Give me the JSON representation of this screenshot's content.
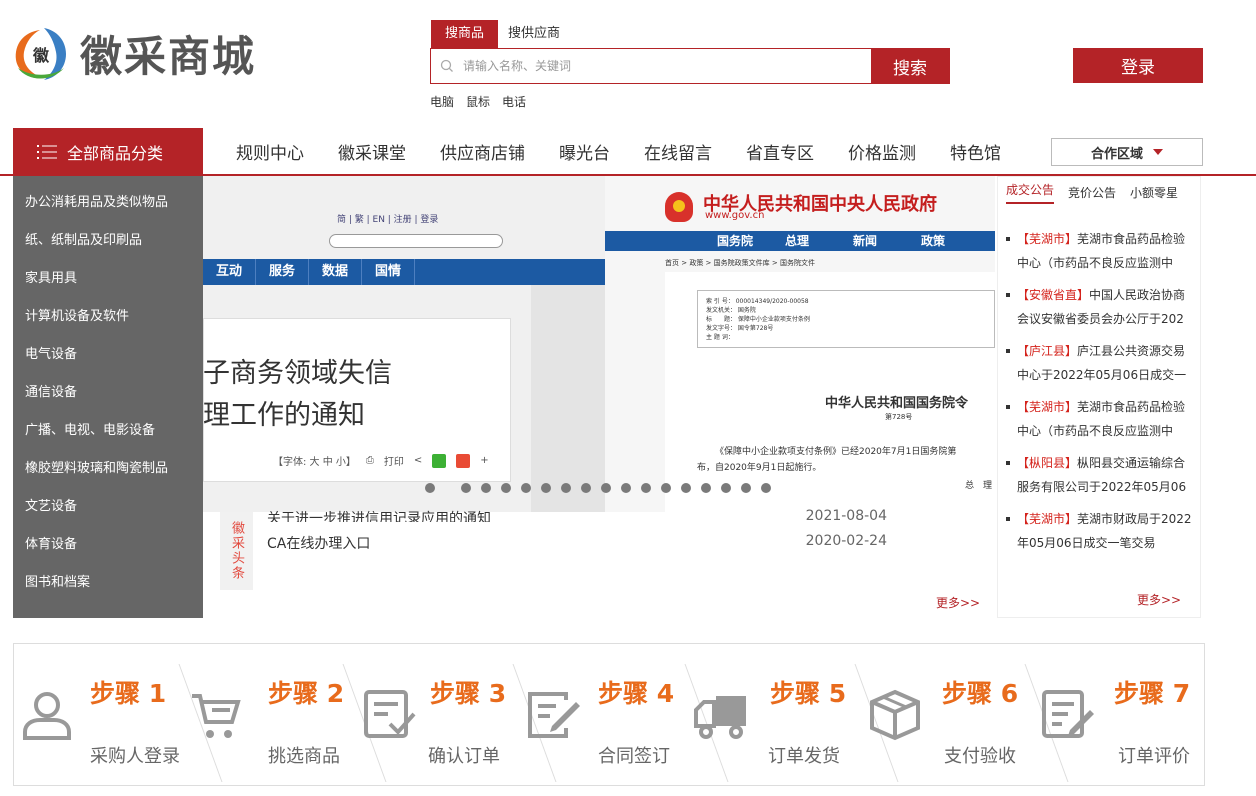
{
  "brand": {
    "name": "徽采商城",
    "logo_char": "徽"
  },
  "search": {
    "tabs": [
      "搜商品",
      "搜供应商"
    ],
    "placeholder": "请输入名称、关键词",
    "button": "搜索",
    "hot_words": [
      "电脑",
      "鼠标",
      "电话"
    ]
  },
  "login": "登录",
  "nav": {
    "all_categories": "全部商品分类",
    "items": [
      "规则中心",
      "徽采课堂",
      "供应商店铺",
      "曝光台",
      "在线留言",
      "省直专区",
      "价格监测",
      "特色馆"
    ],
    "coop_region": "合作区域"
  },
  "categories": [
    "办公消耗用品及类似物品",
    "纸、纸制品及印刷品",
    "家具用具",
    "计算机设备及软件",
    "电气设备",
    "通信设备",
    "广播、电视、电影设备",
    "橡胶塑料玻璃和陶瓷制品",
    "文艺设备",
    "体育设备",
    "图书和档案"
  ],
  "banner": {
    "left": {
      "top_links": "简 | 繁 | EN | 注册 | 登录",
      "nav": [
        "互动",
        "服务",
        "数据",
        "国情"
      ],
      "title_line1": "子商务领域失信",
      "title_line2": "理工作的通知",
      "font_ctrl": "【字体: 大 中 小】",
      "print": "打印",
      "share_plus": "+"
    },
    "right": {
      "title": "中华人民共和国中央人民政府",
      "url": "www.gov.cn",
      "nav": [
        "国务院",
        "总理",
        "新闻",
        "政策"
      ],
      "breadcrumb": "首页 > 政策 > 国务院政策文件库 > 国务院文件",
      "meta": [
        "索 引 号： 000014349/2020-00058",
        "发文机关： 国务院",
        "标　　题： 保障中小企业款项支付条例",
        "发文字号： 国令第728号",
        "主 题 词："
      ],
      "heading": "中华人民共和国国务院令",
      "number": "第728号",
      "para1": "《保障中小企业款项支付条例》已经2020年7月1日国务院第",
      "para2": "布，自2020年9月1日起施行。",
      "sign": "总　理"
    },
    "dot_count": 17
  },
  "headlines": {
    "tag": "徽采头条",
    "items": [
      {
        "title": "关于进一步推进信用记录应用的通知",
        "date": "2021-08-04"
      },
      {
        "title": "CA在线办理入口",
        "date": "2020-02-24"
      }
    ],
    "more": "更多>>"
  },
  "notices": {
    "tabs": [
      "成交公告",
      "竞价公告",
      "小额零星"
    ],
    "items": [
      {
        "region": "【芜湖市】",
        "text": "芜湖市食品药品检验中心（市药品不良反应监测中"
      },
      {
        "region": "【安徽省直】",
        "text": "中国人民政治协商会议安徽省委员会办公厅于202"
      },
      {
        "region": "【庐江县】",
        "text": "庐江县公共资源交易中心于2022年05月06日成交一"
      },
      {
        "region": "【芜湖市】",
        "text": "芜湖市食品药品检验中心（市药品不良反应监测中"
      },
      {
        "region": "【枞阳县】",
        "text": "枞阳县交通运输综合服务有限公司于2022年05月06"
      },
      {
        "region": "【芜湖市】",
        "text": "芜湖市财政局于2022年05月06日成交一笔交易"
      }
    ],
    "more": "更多>>"
  },
  "steps": [
    {
      "label": "步骤 1",
      "desc": "采购人登录",
      "icon": "user-icon"
    },
    {
      "label": "步骤 2",
      "desc": "挑选商品",
      "icon": "cart-icon"
    },
    {
      "label": "步骤 3",
      "desc": "确认订单",
      "icon": "order-check-icon"
    },
    {
      "label": "步骤 4",
      "desc": "合同签订",
      "icon": "contract-sign-icon"
    },
    {
      "label": "步骤 5",
      "desc": "订单发货",
      "icon": "truck-icon"
    },
    {
      "label": "步骤 6",
      "desc": "支付验收",
      "icon": "package-icon"
    },
    {
      "label": "步骤 7",
      "desc": "订单评价",
      "icon": "review-icon"
    }
  ],
  "colors": {
    "brand_red": "#b42327",
    "step_orange": "#e86b1c",
    "region_red": "#d4231c",
    "sidebar_gray": "#666666"
  }
}
